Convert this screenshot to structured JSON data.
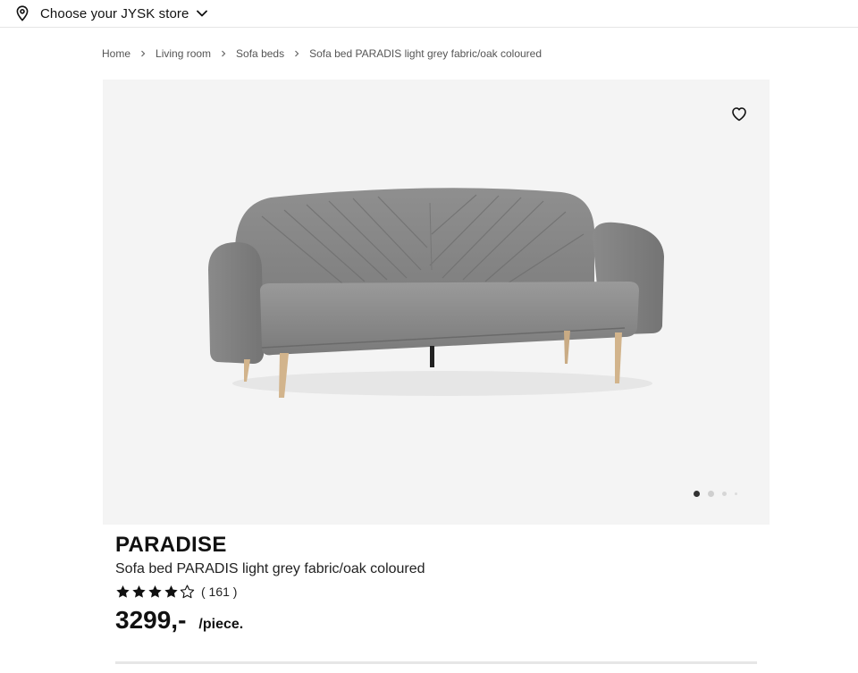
{
  "header": {
    "store_label": "Choose your JYSK store",
    "store_icon": "location-pin-icon",
    "chevron_icon": "chevron-down-icon"
  },
  "breadcrumb": {
    "items": [
      "Home",
      "Living room",
      "Sofa beds",
      "Sofa bed PARADIS light grey fabric/oak coloured"
    ]
  },
  "gallery": {
    "image_alt": "Sofa bed PARADIS light grey fabric/oak coloured",
    "favourite_icon": "heart-icon",
    "image_count": 4,
    "active_index": 0
  },
  "product": {
    "brand": "PARADISE",
    "name": "Sofa bed PARADIS light grey fabric/oak coloured",
    "rating": 4,
    "rating_max": 5,
    "review_count": "( 161 )",
    "price": "3299,-",
    "unit": "/piece."
  },
  "colors": {
    "text": "#111111",
    "gallery_bg": "#f4f4f4",
    "sofa_fabric": "#8c8c8c",
    "sofa_legs": "#d2b48c"
  }
}
